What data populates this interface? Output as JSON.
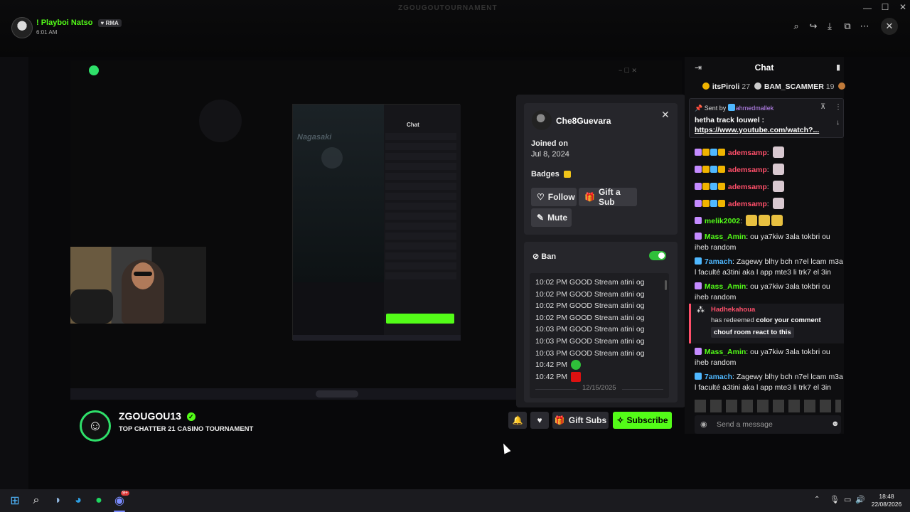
{
  "viewer": {
    "top_center_title": "ZGOUGOUTOURNAMENT",
    "sender_name": "! Playboi Natso",
    "sender_badge": "RMA",
    "time": "6:01 AM"
  },
  "stream": {
    "channel_name": "ZGOUGOU13",
    "stream_title": "TOP CHATTER 21 CASINO TOURNAMENT",
    "buttons": {
      "gift_subs": "Gift Subs",
      "subscribe": "Subscribe"
    },
    "inner_chat_title": "Chat",
    "inner_map_label": "Nagasaki"
  },
  "user_card": {
    "username": "Che8Guevara",
    "joined_label": "Joined on",
    "joined_date": "Jul 8, 2024",
    "badges_label": "Badges",
    "follow": "Follow",
    "gift_sub": "Gift a Sub",
    "mute": "Mute",
    "ban_label": "Ban",
    "ban_enabled": true,
    "messages": [
      {
        "time": "10:02 PM",
        "text": "GOOD Stream atini og"
      },
      {
        "time": "10:02 PM",
        "text": "GOOD Stream atini og"
      },
      {
        "time": "10:02 PM",
        "text": "GOOD Stream atini og"
      },
      {
        "time": "10:02 PM",
        "text": "GOOD Stream atini og"
      },
      {
        "time": "10:03 PM",
        "text": "GOOD Stream atini og"
      },
      {
        "time": "10:03 PM",
        "text": "GOOD Stream atini og"
      },
      {
        "time": "10:03 PM",
        "text": "GOOD Stream atini og"
      },
      {
        "time": "10:42 PM",
        "text": ""
      },
      {
        "time": "10:42 PM",
        "text": ""
      }
    ],
    "date_divider": "12/15/2025"
  },
  "chat": {
    "title": "Chat",
    "leaderboard": [
      {
        "rank": "1",
        "name": "itsPiroli",
        "count": "27"
      },
      {
        "rank": "2",
        "name": "BAM_SCAMMER",
        "count": "19"
      },
      {
        "rank": "3",
        "name": "",
        "count": ""
      }
    ],
    "pinned": {
      "sent_by_label": "Sent by",
      "sent_by_name": "ahmedmallek",
      "text": "hetha track louwel :",
      "link": "https://www.youtube.com/watch?..."
    },
    "messages": [
      {
        "name": "ademsamp",
        "text": "",
        "color": "#ff4f6a"
      },
      {
        "name": "ademsamp",
        "text": "",
        "color": "#ff4f6a"
      },
      {
        "name": "ademsamp",
        "text": "",
        "color": "#ff4f6a"
      },
      {
        "name": "ademsamp",
        "text": "",
        "color": "#ff4f6a"
      },
      {
        "name": "melik2002",
        "text": "",
        "color": "#53fc18"
      },
      {
        "name": "Mass_Amin",
        "text": "ou ya7kiw 3ala tokbri ou iheb random",
        "color": "#53fc18"
      },
      {
        "name": "7amach",
        "text": "Zagewy blhy bch n7el lcam m3a l faculté a3tini aka l app mte3 li trk7 el 3in",
        "color": "#4fb8ff"
      },
      {
        "name": "Mass_Amin",
        "text": "ou ya7kiw 3ala tokbri ou iheb random",
        "color": "#53fc18"
      }
    ],
    "redeem": {
      "user": "Hadhekahoua",
      "text_prefix": "has redeemed",
      "reward": "color your comment",
      "message": "chouf room react to this"
    },
    "messages_after": [
      {
        "name": "Mass_Amin",
        "text": "ou ya7kiw 3ala tokbri ou iheb random",
        "color": "#53fc18"
      },
      {
        "name": "7amach",
        "text": "Zagewy blhy bch n7el lcam m3a l faculté a3tini aka l app mte3 li trk7 el 3in",
        "color": "#4fb8ff"
      }
    ],
    "input_placeholder": "Send a message"
  },
  "taskbar": {
    "time": "18:48",
    "date": "22/08/2026",
    "discord_badge": "9+"
  },
  "colors": {
    "accent": "#53fc18",
    "ban_toggle": "#2fbf3a"
  }
}
